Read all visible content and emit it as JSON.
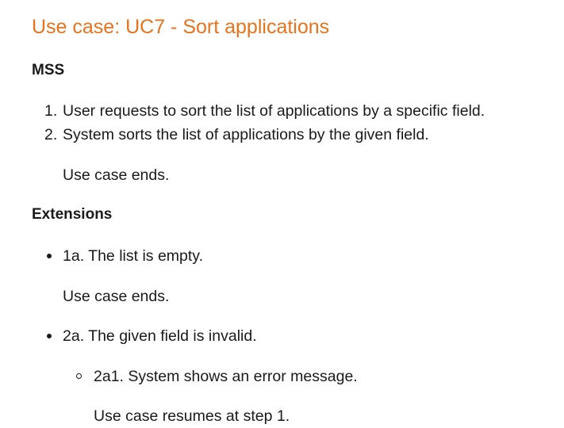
{
  "title": "Use case: UC7 - Sort applications",
  "mss": {
    "heading": "MSS",
    "steps": [
      {
        "number": "1.",
        "text": "User requests to sort the list of applications by a specific field."
      },
      {
        "number": "2.",
        "text": "System sorts the list of applications by the given field."
      }
    ],
    "ending": "Use case ends."
  },
  "extensions": {
    "heading": "Extensions",
    "items": [
      {
        "text": "1a. The list is empty.",
        "note": "Use case ends."
      },
      {
        "text": "2a. The given field is invalid.",
        "subitems": [
          {
            "text": "2a1. System shows an error message.",
            "note": "Use case resumes at step 1."
          }
        ]
      }
    ]
  }
}
